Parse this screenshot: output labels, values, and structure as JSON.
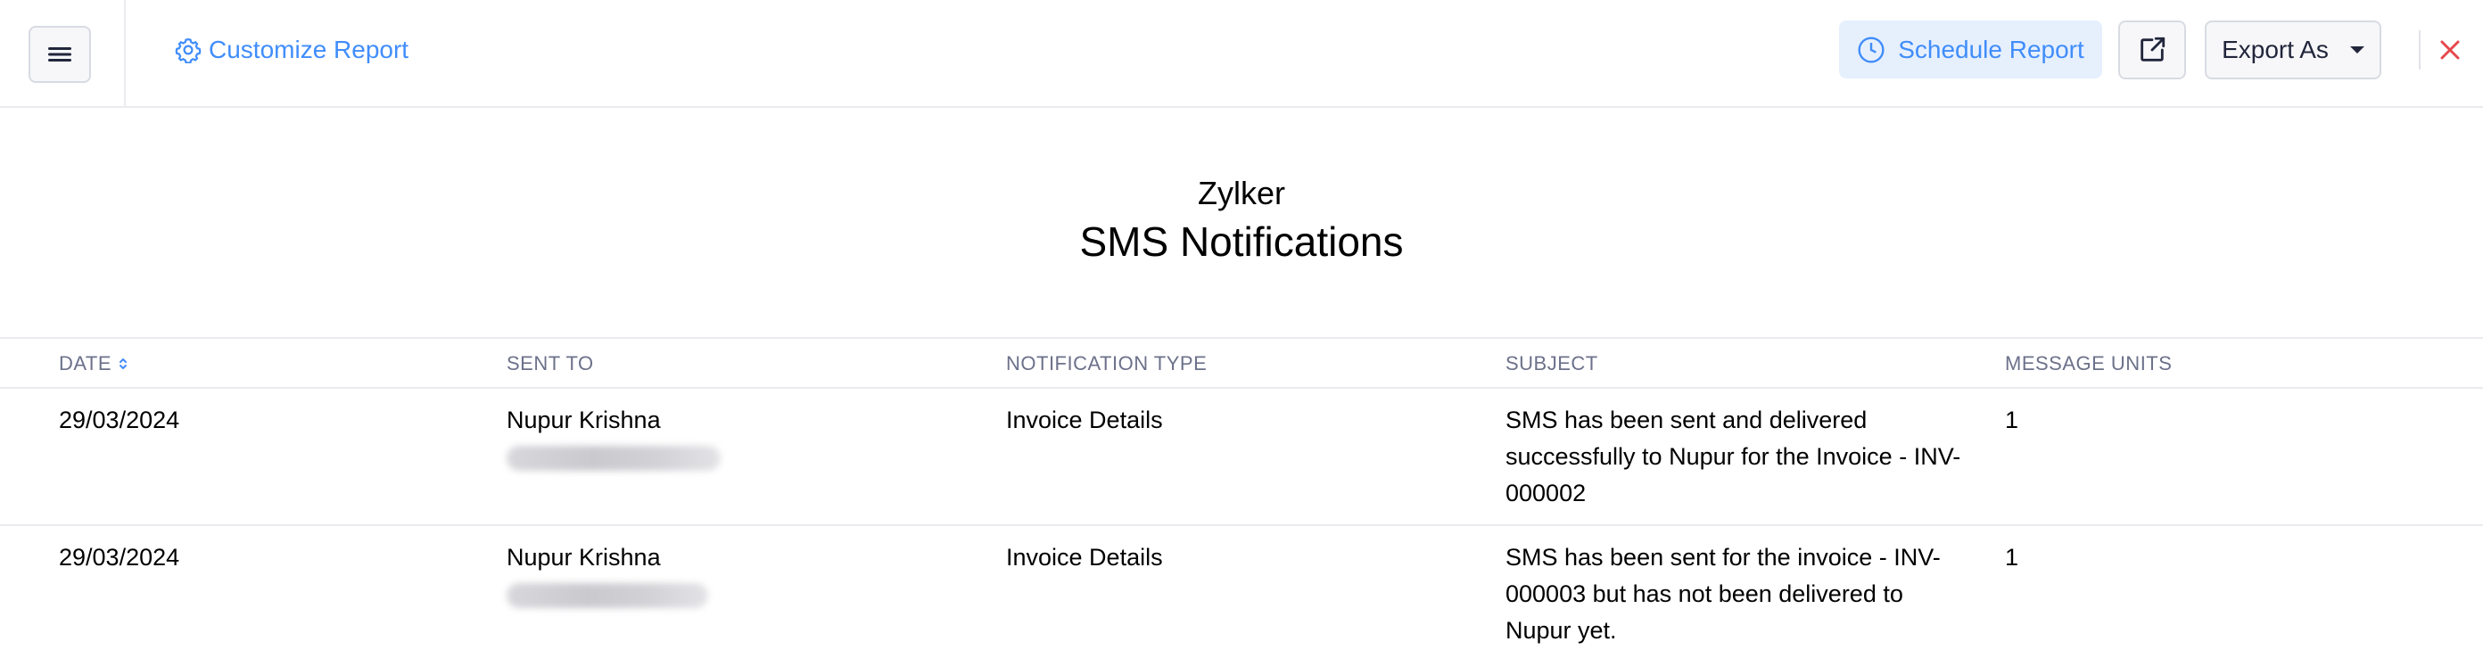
{
  "toolbar": {
    "customize_label": "Customize Report",
    "schedule_label": "Schedule Report",
    "export_label": "Export As",
    "accent_color": "#408dfb",
    "close_color": "#e5484d"
  },
  "report": {
    "organization": "Zylker",
    "title": "SMS Notifications"
  },
  "table": {
    "headers": [
      "DATE",
      "SENT TO",
      "NOTIFICATION TYPE",
      "SUBJECT",
      "MESSAGE UNITS"
    ],
    "rows": [
      {
        "date": "29/03/2024",
        "sent_to": "Nupur Krishna",
        "notification_type": "Invoice Details",
        "subject_lines": [
          "SMS has been sent and delivered",
          "successfully to Nupur for the Invoice - INV-",
          "000002"
        ],
        "message_units": "1"
      },
      {
        "date": "29/03/2024",
        "sent_to": "Nupur Krishna",
        "notification_type": "Invoice Details",
        "subject_lines": [
          "SMS has been sent for the invoice - INV-",
          "000003 but has not been delivered to",
          "Nupur yet."
        ],
        "message_units": "1"
      }
    ]
  }
}
